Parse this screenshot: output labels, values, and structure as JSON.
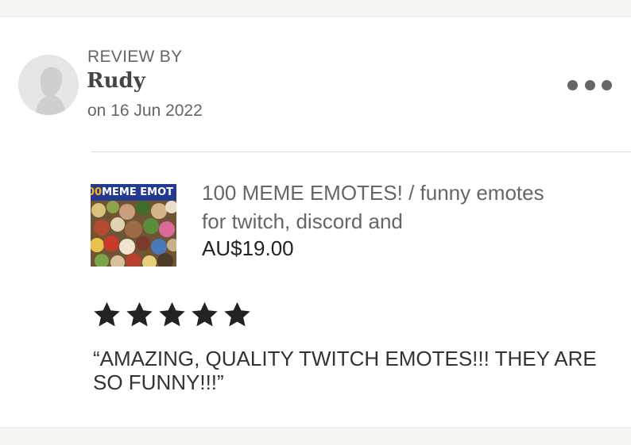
{
  "review": {
    "heading": "REVIEW BY",
    "reviewer_name": "Rudy",
    "date": "on 16 Jun 2022",
    "more_icon": "more-horizontal-icon",
    "rating": 5,
    "rating_max": 5,
    "text": "“AMAZING, QUALITY TWITCH EMOTES!!! THEY ARE SO FUNNY!!!”"
  },
  "product": {
    "thumbnail_text": "MEME EMOT",
    "thumbnail_prefix": "00",
    "title": "100 MEME EMOTES! / funny emotes for twitch, discord and",
    "price": "AU$19.00"
  },
  "colors": {
    "star": "#222222",
    "muted_text": "#666666",
    "banner": "#233a8f"
  }
}
